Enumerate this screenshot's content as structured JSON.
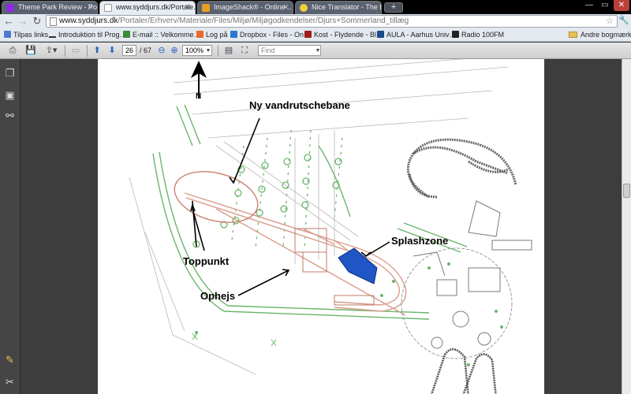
{
  "tabs": [
    {
      "title": "Theme Park Review - Pos…",
      "favicon_color": "#8a2be2"
    },
    {
      "title": "www.syddjurs.dk/Portale…",
      "favicon_color": "#ffffff"
    },
    {
      "title": "ImageShack® - Online …",
      "favicon_color": "#e8a020"
    },
    {
      "title": "Nice Translator - The fast…",
      "favicon_color": "#f0d040"
    }
  ],
  "address": {
    "host": "www.syddjurs.dk",
    "path": "/Portaler/Erhverv/Materiale/Files/Miljø/Miljøgodkendelser/Djurs+Sommerland_tillæg"
  },
  "bookmarks": [
    {
      "label": "Tilpas links",
      "icon_color": "#4a7bd0"
    },
    {
      "label": "Introduktion til Prog…",
      "icon_color": "#333333"
    },
    {
      "label": "E-mail :: Velkomme…",
      "icon_color": "#3a8a3a"
    },
    {
      "label": "Log på",
      "icon_color": "#e86a2a"
    },
    {
      "label": "Dropbox - Files - On…",
      "icon_color": "#2a7ad0"
    },
    {
      "label": "Kost - Flydende - Bl…",
      "icon_color": "#a01c1c"
    },
    {
      "label": "AULA - Aarhus Univ…",
      "icon_color": "#1c4a8a"
    },
    {
      "label": "Radio 100FM",
      "icon_color": "#222222"
    }
  ],
  "other_bookmarks": "Andre bogmærker",
  "pdf_toolbar": {
    "page_current": "26",
    "page_total": "/ 67",
    "zoom": "100%",
    "find_placeholder": "Find"
  },
  "map": {
    "north_label": "N",
    "labels": {
      "new_coaster": "Ny vandrutschebane",
      "splashzone": "Splashzone",
      "top_point": "Toppunkt",
      "lift": "Ophejs"
    },
    "colors": {
      "road_green": "#6ab66a",
      "track_red": "#d99a8a",
      "splash_blue": "#1f55c4",
      "linework": "#9a9a9a"
    }
  }
}
